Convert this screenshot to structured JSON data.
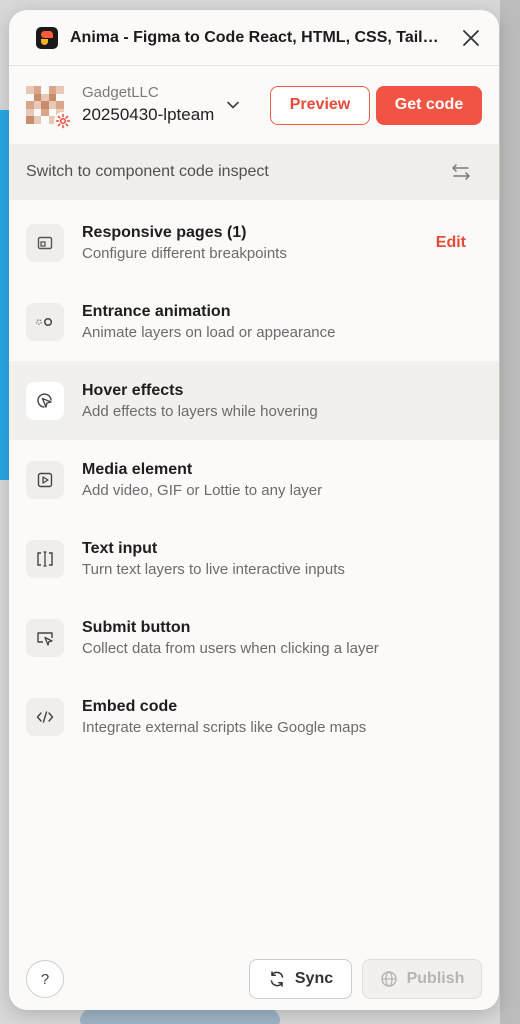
{
  "window": {
    "title": "Anima - Figma to Code React, HTML, CSS, Tailwind"
  },
  "project": {
    "team": "GadgetLLC",
    "file": "20250430-lpteam"
  },
  "actions": {
    "preview": "Preview",
    "get_code": "Get code"
  },
  "switch_bar": {
    "label": "Switch to component code inspect"
  },
  "features": [
    {
      "title": "Responsive pages (1)",
      "desc": "Configure different breakpoints",
      "icon": "responsive-icon",
      "action": "Edit"
    },
    {
      "title": "Entrance animation",
      "desc": "Animate layers on load or appearance",
      "icon": "animation-icon"
    },
    {
      "title": "Hover effects",
      "desc": "Add effects to layers while hovering",
      "icon": "hover-cursor-icon"
    },
    {
      "title": "Media element",
      "desc": "Add video, GIF or Lottie to any layer",
      "icon": "play-icon"
    },
    {
      "title": "Text input",
      "desc": "Turn text layers to live interactive inputs",
      "icon": "text-cursor-icon"
    },
    {
      "title": "Submit button",
      "desc": "Collect data from users when clicking a layer",
      "icon": "click-icon"
    },
    {
      "title": "Embed code",
      "desc": "Integrate external scripts like Google maps",
      "icon": "code-icon"
    }
  ],
  "footer": {
    "help": "?",
    "sync": "Sync",
    "publish": "Publish"
  },
  "colors": {
    "accent": "#f25443",
    "panel_bg": "#fbfaf8"
  }
}
